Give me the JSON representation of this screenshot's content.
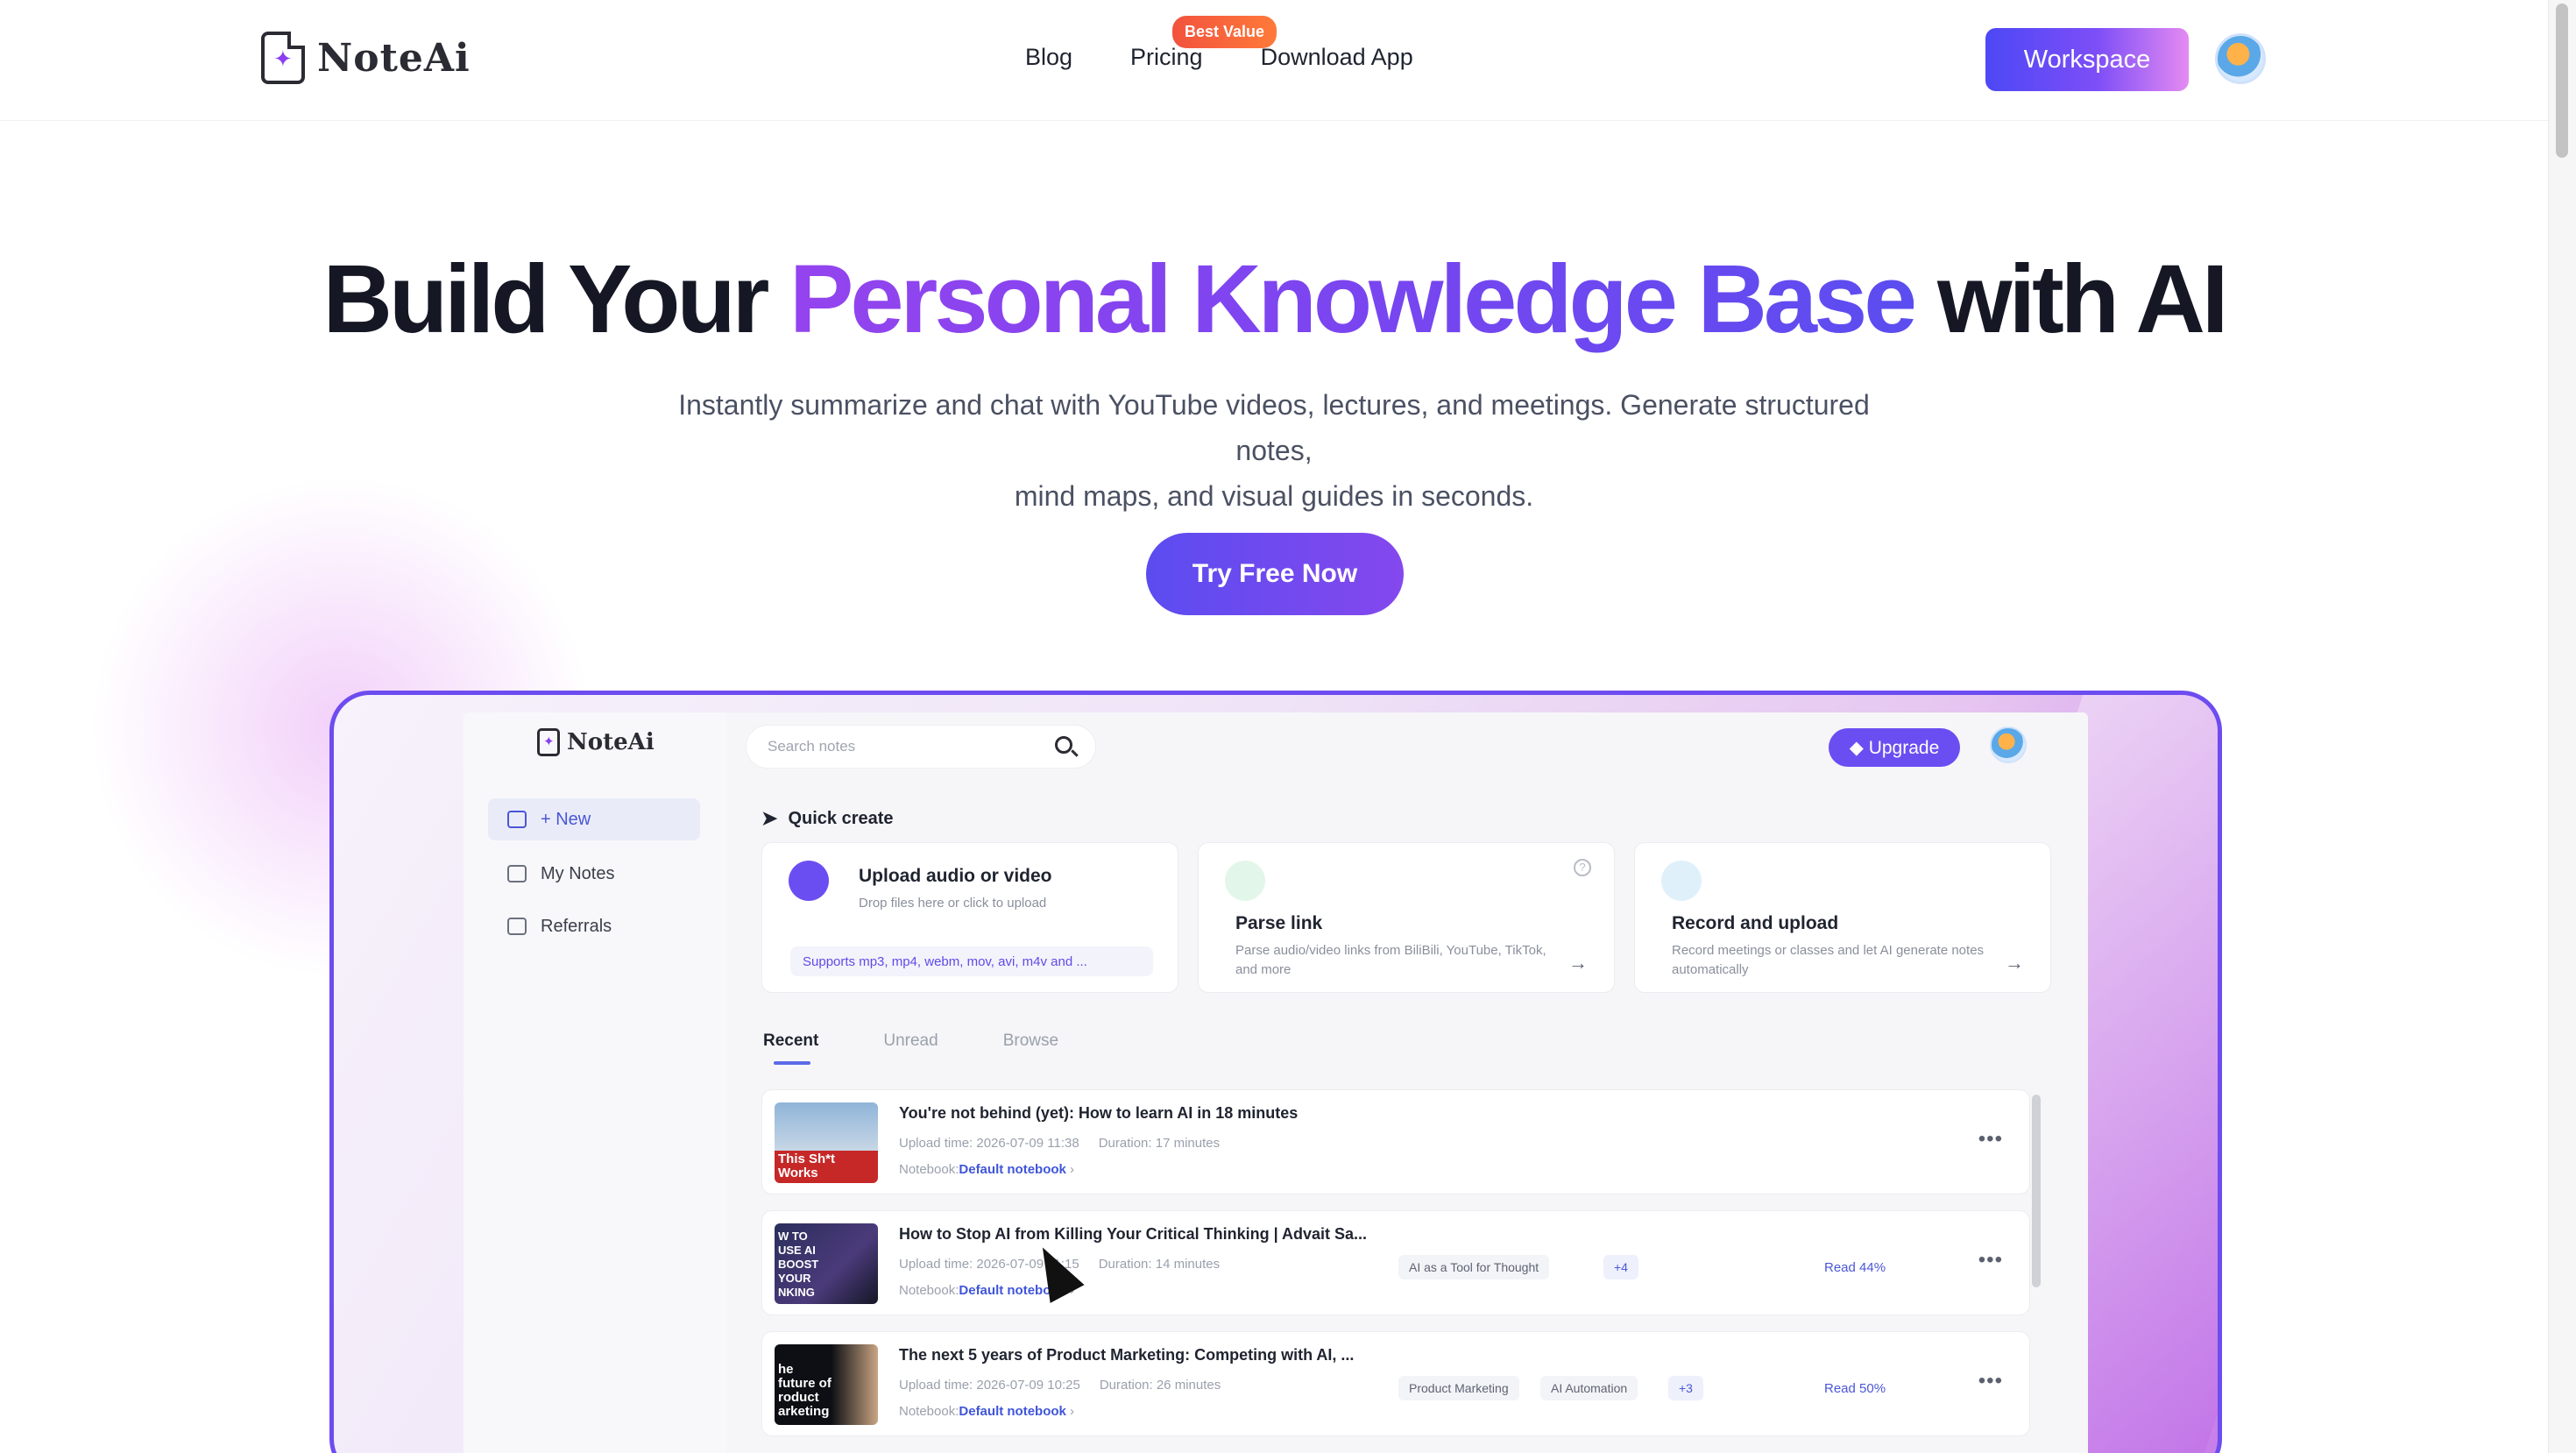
{
  "nav": {
    "logo_text": "NoteAi",
    "links": [
      "Blog",
      "Pricing",
      "Download App"
    ],
    "badge": "Best Value",
    "workspace_label": "Workspace"
  },
  "hero": {
    "title_pre": "Build Your ",
    "title_highlight": "Personal Knowledge Base",
    "title_post": " with AI",
    "subtitle_line1": "Instantly summarize and chat with YouTube videos, lectures, and meetings. Generate structured notes,",
    "subtitle_line2": "mind maps, and visual guides in seconds.",
    "cta": "Try Free Now"
  },
  "app": {
    "logo_text": "NoteAi",
    "search_placeholder": "Search notes",
    "upgrade_label": "Upgrade",
    "sidebar": [
      {
        "label": "+ New",
        "icon": "new-note-icon"
      },
      {
        "label": "My Notes",
        "icon": "folder-icon"
      },
      {
        "label": "Referrals",
        "icon": "gift-icon"
      }
    ],
    "quick_create_label": "Quick create",
    "cards": [
      {
        "title": "Upload audio or video",
        "desc": "Drop files here or click to upload",
        "chip": "Supports mp3, mp4, webm, mov, avi, m4v and ..."
      },
      {
        "title": "Parse link",
        "desc": "Parse audio/video links from BiliBili, YouTube, TikTok, and more"
      },
      {
        "title": "Record and upload",
        "desc": "Record meetings or classes and let AI generate notes automatically"
      }
    ],
    "tabs": [
      "Recent",
      "Unread",
      "Browse"
    ],
    "notebook_label": "Notebook:",
    "notes": [
      {
        "title": "You're not behind (yet): How to learn AI in 18 minutes",
        "upload": "Upload time: 2026-07-09 11:38",
        "duration": "Duration: 17 minutes",
        "notebook": "Default notebook",
        "thumb_caption": "This Sh*t Works",
        "tags": [],
        "read": ""
      },
      {
        "title": "How to Stop AI from Killing Your Critical Thinking | Advait Sa...",
        "upload": "Upload time: 2026-07-09 11:15",
        "duration": "Duration: 14 minutes",
        "notebook": "Default notebook",
        "thumb_caption": "W TO USE AI BOOST YOUR NKING",
        "tags": [
          "AI as a Tool for Thought",
          "+4"
        ],
        "read": "Read 44%"
      },
      {
        "title": "The next 5 years of Product Marketing: Competing with AI, ...",
        "upload": "Upload time: 2026-07-09 10:25",
        "duration": "Duration: 26 minutes",
        "notebook": "Default notebook",
        "thumb_caption": "he future of roduct arketing",
        "tags": [
          "Product Marketing",
          "AI Automation",
          "+3"
        ],
        "read": "Read 50%"
      }
    ]
  },
  "colors": {
    "brand": "#6b4ef2",
    "accent_purple": "#8b3ff0",
    "badge": "#f2523d"
  }
}
